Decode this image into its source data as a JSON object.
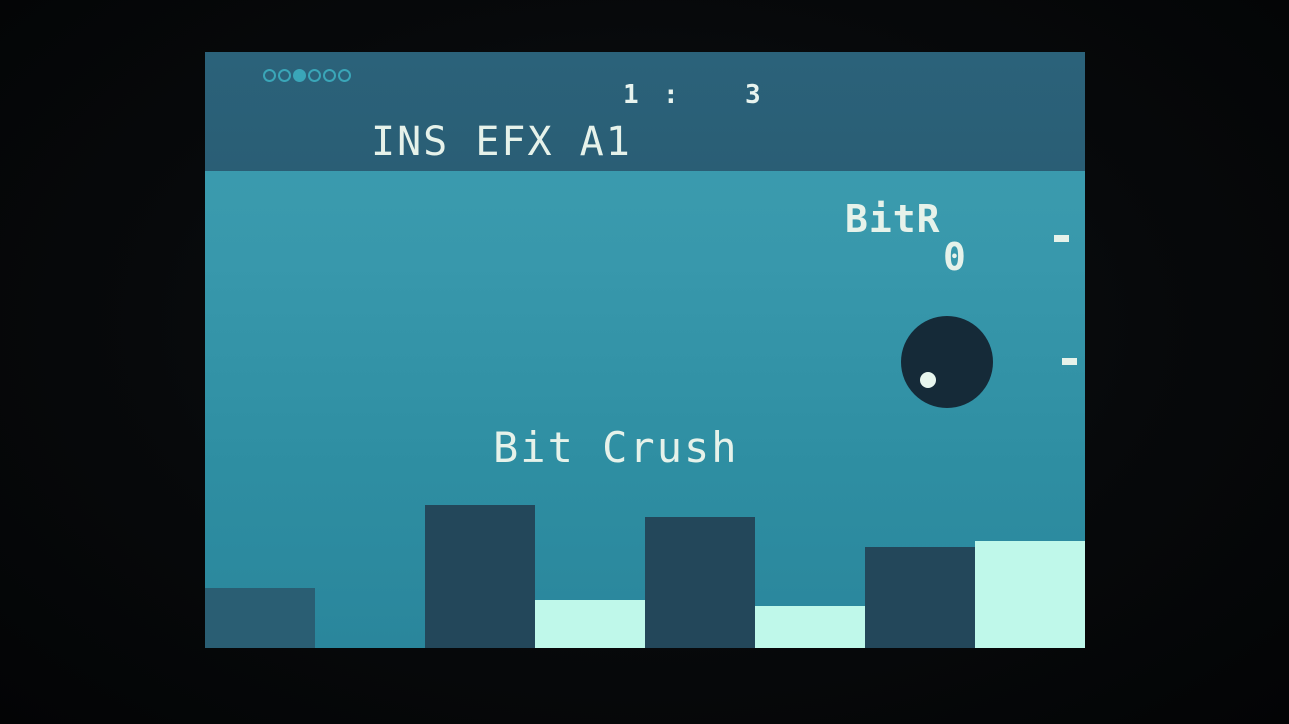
{
  "header": {
    "page_indicator": [
      false,
      false,
      true,
      false,
      false,
      false
    ],
    "counter_left": "1",
    "counter_sep": ":",
    "counter_right": "3",
    "title": "INS EFX A1"
  },
  "parameter": {
    "name": "BitR",
    "value": "0"
  },
  "effect": {
    "name": "Bit Crush"
  },
  "bars": [
    {
      "level": 0.1,
      "color": "#2a5e73"
    },
    {
      "level": 0.0,
      "color": "#3898ac"
    },
    {
      "level": 0.24,
      "color": "#23475a"
    },
    {
      "level": 0.08,
      "color": "#bff8ea"
    },
    {
      "level": 0.22,
      "color": "#23475a"
    },
    {
      "level": 0.07,
      "color": "#bff8ea"
    },
    {
      "level": 0.17,
      "color": "#23475a"
    },
    {
      "level": 0.18,
      "color": "#bff8ea"
    }
  ],
  "colors": {
    "screen": "#3898ac",
    "header": "#2b627a",
    "text": "#e6f2ea",
    "knob": "#152a38"
  }
}
